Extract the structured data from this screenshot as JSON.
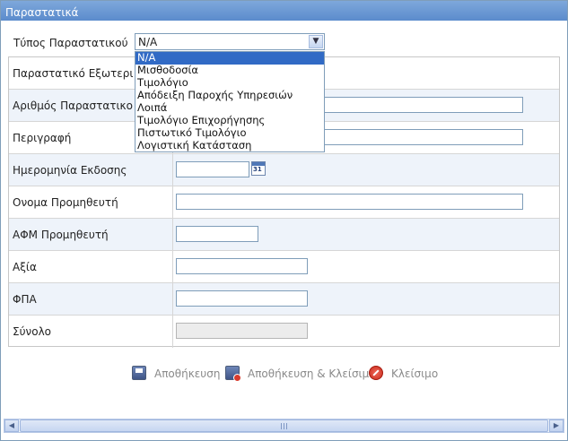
{
  "window": {
    "title": "Παραστατικά"
  },
  "type_field": {
    "label": "Τύπος Παραστατικού",
    "value": "N/A",
    "options": [
      "N/A",
      "Μισθοδοσία",
      "Τιμολόγιο",
      "Απόδειξη Παροχής Υπηρεσιών",
      "Λοιπά",
      "Τιμολόγιο Επιχορήγησης",
      "Πιστωτικό Τιμολόγιο",
      "Λογιστική Κατάσταση"
    ]
  },
  "form": {
    "rows": [
      {
        "label": "Παραστατικό Εξωτερι",
        "value": ""
      },
      {
        "label": "Αριθμός Παραστατικο",
        "value": ""
      },
      {
        "label": "Περιγραφή",
        "value": ""
      },
      {
        "label": "Ημερομηνία Εκδοσης",
        "value": ""
      },
      {
        "label": "Ονομα Προμηθευτή",
        "value": ""
      },
      {
        "label": "ΑΦΜ Προμηθευτή",
        "value": ""
      },
      {
        "label": "Αξία",
        "value": ""
      },
      {
        "label": "ΦΠΑ",
        "value": ""
      },
      {
        "label": "Σύνολο",
        "value": ""
      }
    ],
    "calendar_icon_text": "31"
  },
  "actions": {
    "save": "Αποθήκευση",
    "save_close": "Αποθήκευση & Κλείσιμο",
    "close": "Κλείσιμο"
  },
  "icons": {
    "dropdown_arrow": "chevron-down-icon",
    "calendar": "calendar-icon",
    "save": "floppy-disk-icon",
    "save_close": "floppy-disk-close-icon",
    "close": "close-circle-icon"
  },
  "colors": {
    "title_bar": "#5b8bcc",
    "selected_option": "#316ac5",
    "alt_row": "#eef3fa"
  }
}
